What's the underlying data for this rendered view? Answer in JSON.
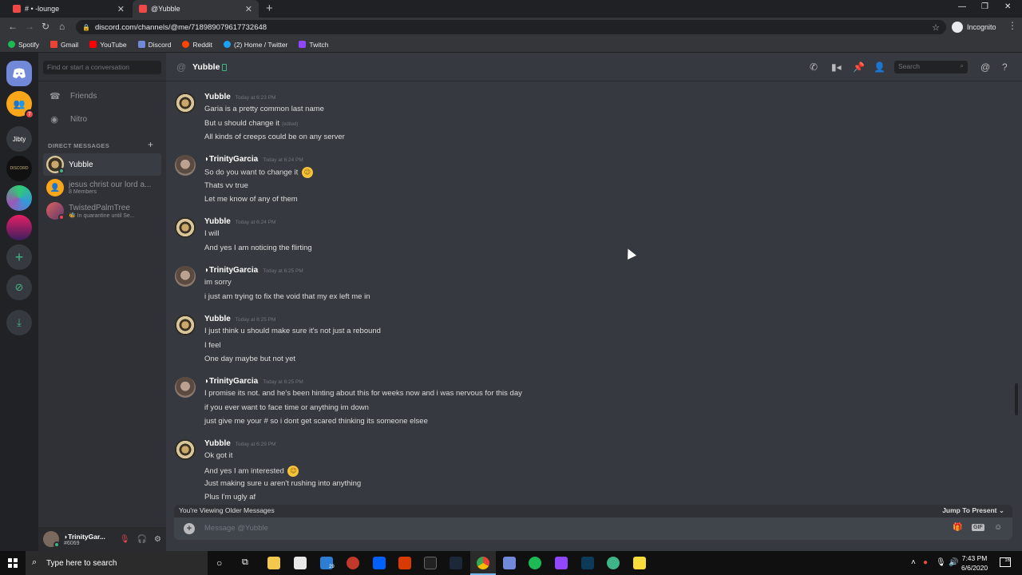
{
  "browser": {
    "tabs": [
      {
        "label": "# • -lounge"
      },
      {
        "label": "@Yubble"
      }
    ],
    "url": "discord.com/channels/@me/718989079617732648",
    "incognito_label": "Incognito",
    "bookmarks": [
      {
        "label": "Spotify",
        "color": "#1db954"
      },
      {
        "label": "Gmail",
        "color": "#ea4335"
      },
      {
        "label": "YouTube",
        "color": "#ff0000"
      },
      {
        "label": "Discord",
        "color": "#7289da"
      },
      {
        "label": "Reddit",
        "color": "#ff4500"
      },
      {
        "label": "(2) Home / Twitter",
        "color": "#1da1f2"
      },
      {
        "label": "Twitch",
        "color": "#9146ff"
      }
    ]
  },
  "guilds": {
    "items": [
      {
        "name": "home",
        "label": ""
      },
      {
        "name": "group",
        "label": "",
        "badge": "7"
      },
      {
        "name": "jibty",
        "label": "Jibty"
      },
      {
        "name": "discord-server",
        "label": "DISCORD"
      },
      {
        "name": "globe-server",
        "label": ""
      },
      {
        "name": "pink-server",
        "label": ""
      }
    ]
  },
  "sidebar": {
    "search_placeholder": "Find or start a conversation",
    "nav": [
      {
        "label": "Friends"
      },
      {
        "label": "Nitro"
      }
    ],
    "dm_header": "DIRECT MESSAGES",
    "dms": [
      {
        "name": "Yubble",
        "sub": ""
      },
      {
        "name": "jesus christ our lord a...",
        "sub": "8 Members"
      },
      {
        "name": "TwistedPalmTree",
        "sub": "🐝 In quarantine until Se..."
      }
    ],
    "user": {
      "name": "◗TrinityGar...",
      "tag": "#6069"
    }
  },
  "chat": {
    "title": "Yubble",
    "search_placeholder": "Search",
    "messages": [
      {
        "author": "Yubble",
        "time": "Today at 6:23 PM",
        "lines": [
          "Garia is a pretty common last name",
          "But u should change it",
          "All kinds of creeps could be on any server"
        ],
        "edited": "(edited)"
      },
      {
        "author": "◗TrinityGarcia",
        "time": "Today at 6:24 PM",
        "lines": [
          "So do you want to change it",
          "Thats vv true",
          "Let me know of any of them"
        ]
      },
      {
        "author": "Yubble",
        "time": "Today at 6:24 PM",
        "lines": [
          "I will",
          "And yes I am noticing the flirting"
        ]
      },
      {
        "author": "◗TrinityGarcia",
        "time": "Today at 6:25 PM",
        "lines": [
          "im sorry",
          "i just am trying to fix the void that my ex left me in"
        ]
      },
      {
        "author": "Yubble",
        "time": "Today at 6:25 PM",
        "lines": [
          "I just think u should make sure it's not just a rebound",
          "I feel",
          "One day maybe but not yet"
        ]
      },
      {
        "author": "◗TrinityGarcia",
        "time": "Today at 6:25 PM",
        "lines": [
          "I promise its not. and he's been hinting about this for weeks now and i was nervous for this day",
          "if you ever want to face time or anything im down",
          "just give me your # so i dont get scared thinking its someone elsee"
        ]
      },
      {
        "author": "Yubble",
        "time": "Today at 6:29 PM",
        "lines": [
          "Ok got it",
          "And yes I am interested",
          "Just making sure u aren't rushing into anything",
          "Plus I'm ugly af"
        ]
      }
    ],
    "older_notice": "You're Viewing Older Messages",
    "jump_label": "Jump To Present",
    "composer_placeholder": "Message @Yubble",
    "gif_label": "GIF"
  },
  "taskbar": {
    "search_placeholder": "Type here to search",
    "time": "7:43 PM",
    "date": "6/6/2020",
    "notifications": "16",
    "mail_badge": "29"
  },
  "colors": {
    "discord_bg": "#36393f",
    "sidebar_bg": "#2f3136",
    "guild_bg": "#202225",
    "accent": "#7289da",
    "online": "#43b581",
    "dnd": "#f04747"
  }
}
